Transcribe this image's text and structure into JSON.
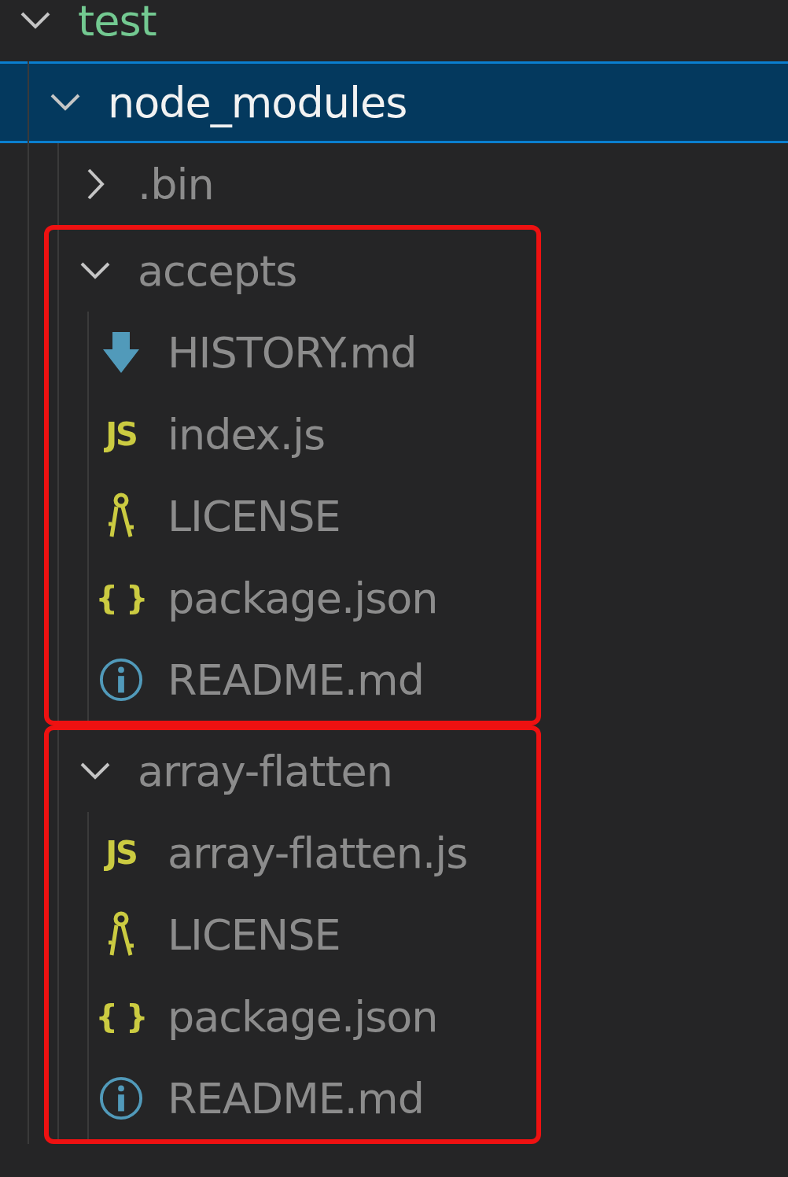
{
  "explorer": {
    "tree": [
      {
        "name": "test",
        "kind": "folder",
        "expanded": true,
        "selected": false,
        "untracked": true,
        "ignored": false,
        "highlighted": false,
        "children": [
          {
            "name": "node_modules",
            "kind": "folder",
            "expanded": true,
            "selected": true,
            "untracked": false,
            "ignored": true,
            "highlighted": false,
            "children": [
              {
                "name": ".bin",
                "kind": "folder",
                "expanded": false,
                "selected": false,
                "untracked": false,
                "ignored": true,
                "highlighted": false
              },
              {
                "name": "accepts",
                "kind": "folder",
                "expanded": true,
                "selected": false,
                "untracked": false,
                "ignored": true,
                "highlighted": true,
                "children": [
                  {
                    "name": "HISTORY.md",
                    "kind": "markdown",
                    "selected": false,
                    "untracked": false,
                    "ignored": true
                  },
                  {
                    "name": "index.js",
                    "kind": "js",
                    "icon_text": "JS",
                    "selected": false,
                    "untracked": false,
                    "ignored": true
                  },
                  {
                    "name": "LICENSE",
                    "kind": "license",
                    "selected": false,
                    "untracked": false,
                    "ignored": true
                  },
                  {
                    "name": "package.json",
                    "kind": "json",
                    "icon_text": "{ }",
                    "selected": false,
                    "untracked": false,
                    "ignored": true
                  },
                  {
                    "name": "README.md",
                    "kind": "info",
                    "selected": false,
                    "untracked": false,
                    "ignored": true
                  }
                ]
              },
              {
                "name": "array-flatten",
                "kind": "folder",
                "expanded": true,
                "selected": false,
                "untracked": false,
                "ignored": true,
                "highlighted": true,
                "children": [
                  {
                    "name": "array-flatten.js",
                    "kind": "js",
                    "icon_text": "JS",
                    "selected": false,
                    "untracked": false,
                    "ignored": true
                  },
                  {
                    "name": "LICENSE",
                    "kind": "license",
                    "selected": false,
                    "untracked": false,
                    "ignored": true
                  },
                  {
                    "name": "package.json",
                    "kind": "json",
                    "icon_text": "{ }",
                    "selected": false,
                    "untracked": false,
                    "ignored": true
                  },
                  {
                    "name": "README.md",
                    "kind": "info",
                    "selected": false,
                    "untracked": false,
                    "ignored": true
                  }
                ]
              }
            ]
          }
        ]
      }
    ]
  }
}
